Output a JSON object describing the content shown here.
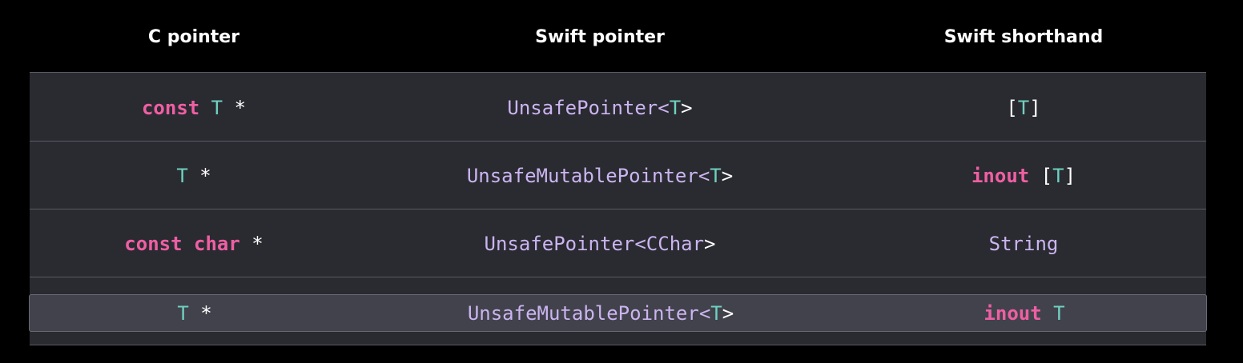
{
  "columns": [
    "C pointer",
    "Swift pointer",
    "Swift shorthand"
  ],
  "rows": [
    {
      "c_pointer": [
        {
          "text": "const",
          "kind": "keyword"
        },
        {
          "text": " ",
          "kind": "plain"
        },
        {
          "text": "T",
          "kind": "type"
        },
        {
          "text": " *",
          "kind": "plain"
        }
      ],
      "swift_pointer": [
        {
          "text": "UnsafePointer<",
          "kind": "swift"
        },
        {
          "text": "T",
          "kind": "type"
        },
        {
          "text": ">",
          "kind": "plain"
        }
      ],
      "swift_shorthand": [
        {
          "text": "[",
          "kind": "plain"
        },
        {
          "text": "T",
          "kind": "type"
        },
        {
          "text": "]",
          "kind": "plain"
        }
      ]
    },
    {
      "c_pointer": [
        {
          "text": "T",
          "kind": "type"
        },
        {
          "text": " *",
          "kind": "plain"
        }
      ],
      "swift_pointer": [
        {
          "text": "UnsafeMutablePointer<",
          "kind": "swift"
        },
        {
          "text": "T",
          "kind": "type"
        },
        {
          "text": ">",
          "kind": "plain"
        }
      ],
      "swift_shorthand": [
        {
          "text": "inout",
          "kind": "keyword"
        },
        {
          "text": " [",
          "kind": "plain"
        },
        {
          "text": "T",
          "kind": "type"
        },
        {
          "text": "]",
          "kind": "plain"
        }
      ]
    },
    {
      "c_pointer": [
        {
          "text": "const char",
          "kind": "keyword"
        },
        {
          "text": " *",
          "kind": "plain"
        }
      ],
      "swift_pointer": [
        {
          "text": "UnsafePointer<CChar",
          "kind": "swift"
        },
        {
          "text": ">",
          "kind": "plain"
        }
      ],
      "swift_shorthand": [
        {
          "text": "String",
          "kind": "swift"
        }
      ]
    },
    {
      "highlighted": true,
      "c_pointer": [
        {
          "text": "T",
          "kind": "type"
        },
        {
          "text": " *",
          "kind": "plain"
        }
      ],
      "swift_pointer": [
        {
          "text": "UnsafeMutablePointer<",
          "kind": "swift"
        },
        {
          "text": "T",
          "kind": "type"
        },
        {
          "text": ">",
          "kind": "plain"
        }
      ],
      "swift_shorthand": [
        {
          "text": "inout",
          "kind": "keyword"
        },
        {
          "text": " ",
          "kind": "plain"
        },
        {
          "text": "T",
          "kind": "type"
        }
      ]
    }
  ],
  "colors": {
    "background": "#000000",
    "table_background": "#2a2a31",
    "highlight_row": "#42424c",
    "keyword": "#ee5fa3",
    "type": "#6fd1c0",
    "swift_identifier": "#cbb5f0",
    "plain": "#ffffff"
  }
}
